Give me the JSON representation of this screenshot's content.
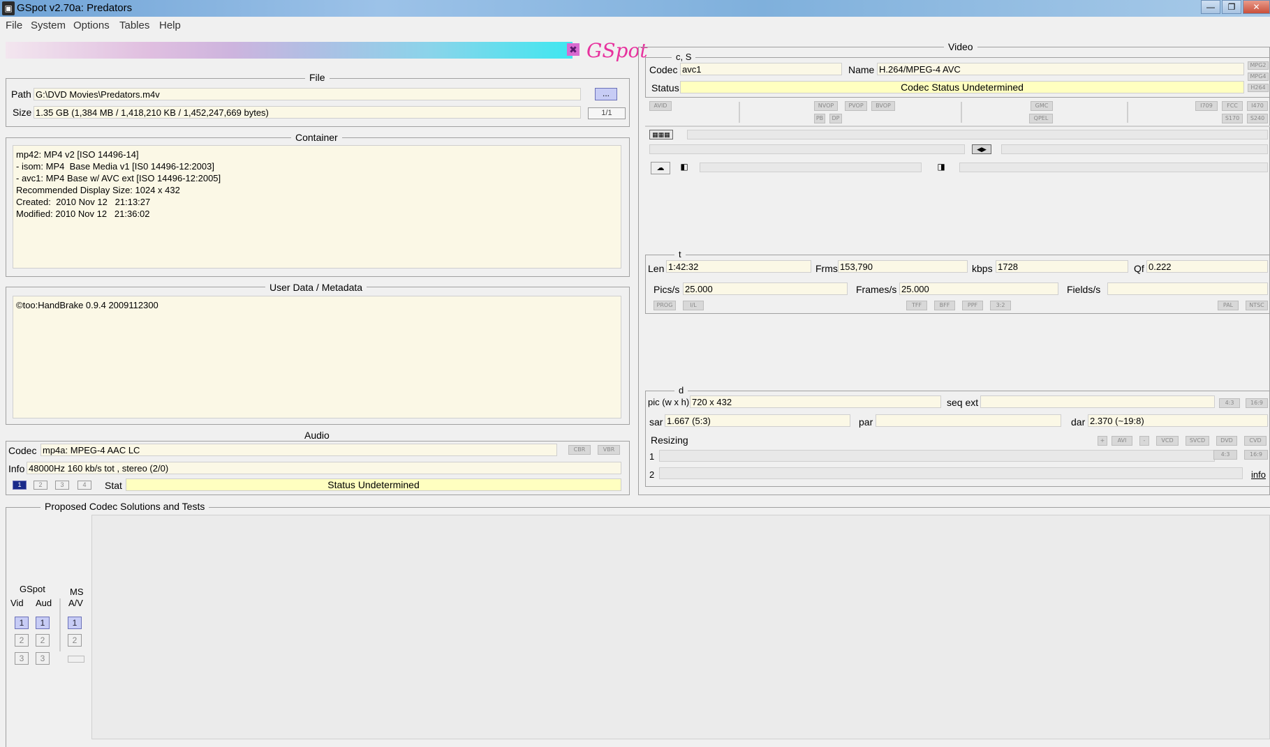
{
  "window": {
    "title": "GSpot v2.70a: Predators"
  },
  "menu": [
    "File",
    "System",
    "Options",
    "Tables",
    "Help"
  ],
  "logo_text": "GSpot",
  "file": {
    "legend": "File",
    "path_label": "Path",
    "path": "G:\\DVD Movies\\Predators.m4v",
    "browse_label": "...",
    "size_label": "Size",
    "size": "1.35 GB (1,384 MB / 1,418,210 KB / 1,452,247,669 bytes)",
    "page": "1/1"
  },
  "container": {
    "legend": "Container",
    "text": "mp42: MP4 v2 [ISO 14496-14]\n- isom: MP4  Base Media v1 [IS0 14496-12:2003]\n- avc1: MP4 Base w/ AVC ext [ISO 14496-12:2005]\nRecommended Display Size: 1024 x 432\nCreated:  2010 Nov 12   21:13:27\nModified: 2010 Nov 12   21:36:02"
  },
  "userdata": {
    "legend": "User Data / Metadata",
    "text": "©too:HandBrake 0.9.4 2009112300"
  },
  "audio": {
    "legend": "Audio",
    "codec_label": "Codec",
    "codec": "mp4a: MPEG-4 AAC LC",
    "cbr": "CBR",
    "vbr": "VBR",
    "info_label": "Info",
    "info": "48000Hz  160 kb/s tot , stereo (2/0)",
    "streams": [
      "1",
      "2",
      "3",
      "4"
    ],
    "stat_label": "Stat",
    "status": "Status Undetermined"
  },
  "video": {
    "legend": "Video",
    "cs_legend": "c, S",
    "codec_label": "Codec",
    "codec": "avc1",
    "name_label": "Name",
    "name": "H.264/MPEG-4 AVC",
    "status_label": "Status",
    "status": "Codec Status Undetermined",
    "side_tags": [
      "MPG2",
      "MPG4",
      "H264"
    ],
    "flags_row1": [
      "AVID",
      "NVOP",
      "PVOP",
      "BVOP",
      "GMC",
      "I709",
      "FCC",
      "I470"
    ],
    "flags_row2": [
      "PB",
      "DP",
      "QPEL",
      "S170",
      "S240"
    ],
    "t_legend": "t",
    "len_label": "Len",
    "len": "1:42:32",
    "frms_label": "Frms",
    "frms": "153,790",
    "kbps_label": "kbps",
    "kbps": "1728",
    "qf_label": "Qf",
    "qf": "0.222",
    "pics_label": "Pics/s",
    "pics": "25.000",
    "frames_label": "Frames/s",
    "frames": "25.000",
    "fields_label": "Fields/s",
    "fields": "",
    "flags_row3": [
      "PROG",
      "I/L",
      "TFF",
      "BFF",
      "PPF",
      "3:2",
      "PAL",
      "NTSC"
    ],
    "d_legend": "d",
    "pic_label": "pic (w x h)",
    "pic": "720 x 432",
    "seqext_label": "seq ext",
    "seqext": "",
    "ar_tags": [
      "4:3",
      "16:9"
    ],
    "sar_label": "sar",
    "sar": "1.667 (5:3)",
    "par_label": "par",
    "par": "",
    "dar_label": "dar",
    "dar": "2.370 (~19:8)",
    "resizing_label": "Resizing",
    "resize_tags": [
      "+",
      "AVI",
      "-",
      "VCD",
      "SVCD",
      "DVD",
      "CVD"
    ],
    "resize_rows": [
      "1",
      "2"
    ],
    "resize_ar_tags": [
      "4:3",
      "16:9"
    ],
    "info_link": "info"
  },
  "proposed": {
    "legend": "Proposed Codec Solutions and Tests",
    "gspot_label": "GSpot",
    "vid_label": "Vid",
    "aud_label": "Aud",
    "ms_label": "MS",
    "av_label": "A/V",
    "nums": [
      "1",
      "2",
      "3"
    ]
  }
}
